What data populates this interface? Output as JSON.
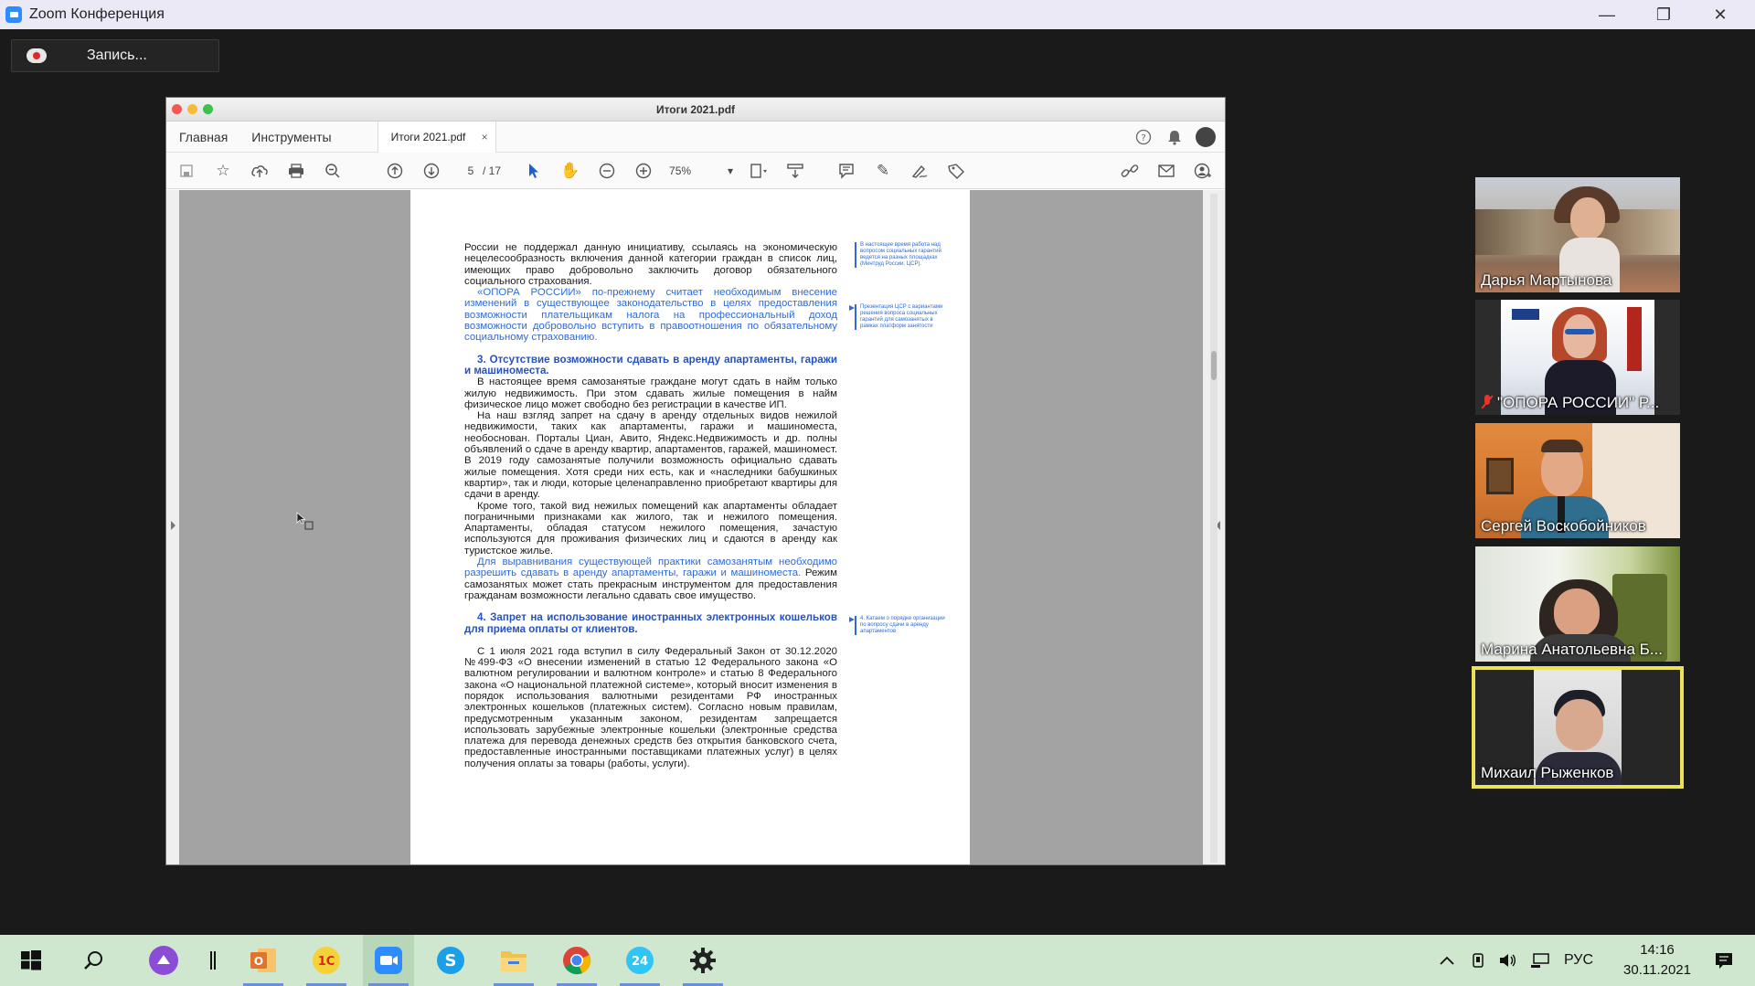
{
  "zoom_window": {
    "title": "Zoom Конференция",
    "minimize": "—",
    "restore": "❐",
    "close": "✕",
    "recording_label": "Запись..."
  },
  "pdf_viewer": {
    "window_title": "Итоги 2021.pdf",
    "menu": {
      "home": "Главная",
      "tools": "Инструменты"
    },
    "tab_title": "Итоги 2021.pdf",
    "tab_close": "×",
    "page_current": "5",
    "page_total": "/ 17",
    "zoom": "75%",
    "zoom_caret": "▾"
  },
  "document": {
    "para1": "России не поддержал данную инициативу, ссылаясь на экономическую нецелесообразность включения данной категории граждан в список лиц, имеющих право добровольно заключить договор обязательного социального страхования.",
    "para2": "«ОПОРА РОССИИ» по-прежнему считает необходимым внесение изменений в существующее законодательство в целях предоставления возможности плательщикам налога на профессиональный доход возможности добровольно вступить в правоотношения по обязательному социальному страхованию.",
    "heading3": "3. Отсутствие возможности сдавать в аренду апартаменты, гаражи и машиноместа.",
    "para3": "В настоящее время самозанятые граждане могут сдать в найм только жилую недвижимость. При этом сдавать жилые помещения в найм физическое лицо может свободно без регистрации в качестве ИП.",
    "para4": "На наш взгляд запрет на сдачу в аренду отдельных видов нежилой недвижимости, таких как апартаменты, гаражи и машиноместа, необоснован. Порталы Циан, Авито, Яндекс.Недвижимость и др. полны объявлений о сдаче в аренду квартир, апартаментов, гаражей, машиномест. В 2019 году самозанятые получили возможность официально сдавать жилые помещения. Хотя среди них есть, как и «наследники бабушкиных квартир», так и люди, которые целенаправленно приобретают квартиры для сдачи в аренду.",
    "para5": "Кроме того, такой вид нежилых помещений как апартаменты обладает пограничными признаками как жилого, так и нежилого помещения. Апартаменты, обладая статусом нежилого помещения, зачастую используются для проживания физических лиц и сдаются в аренду как туристское жилье.",
    "para6_blue": "Для выравнивания существующей практики самозанятым необходимо разрешить сдавать в аренду апартаменты, гаражи и машиноместа.",
    "para6_black": " Режим самозанятых может стать прекрасным инструментом для предоставления гражданам возможности легально сдавать свое имущество.",
    "heading4": "4. Запрет на использование иностранных электронных кошельков для приема оплаты от клиентов.",
    "para7": "С 1 июля 2021 года вступил в силу Федеральный Закон от 30.12.2020 №499-ФЗ «О внесении изменений в статью 12 Федерального закона «О валютном регулировании и валютном контроле» и статью 8 Федерального закона «О национальной платежной системе», который вносит изменения в порядок использования валютными резидентами РФ иностранных электронных кошельков (платежных систем). Согласно новым правилам, предусмотренным указанным законом, резидентам запрещается использовать зарубежные электронные кошельки (электронные средства платежа для перевода денежных средств без открытия банковского счета, предоставленные иностранными поставщиками платежных услуг) в целях получения оплаты за товары (работы, услуги).",
    "note1": "В настоящее время работа над вопросом социальных гарантий ведется на разных площадках (Минтруд России, ЦСР).",
    "note2": "Презентация ЦСР с вариантами решения вопроса социальных гарантий для самозанятых в рамках платформ занятости",
    "note3": "4. Катаем о порядке организации по вопросу сдачи в аренду апартаментов"
  },
  "participants": [
    {
      "name": "Дарья Мартынова",
      "muted": false,
      "active": false
    },
    {
      "name": "\"ОПОРА РОССИИ\" Р...",
      "muted": true,
      "active": false
    },
    {
      "name": "Сергей Воскобойников",
      "muted": false,
      "active": false
    },
    {
      "name": "Марина Анатольевна Б...",
      "muted": false,
      "active": false
    },
    {
      "name": "Михаил Рыженков",
      "muted": false,
      "active": true
    }
  ],
  "taskbar": {
    "language": "РУС",
    "time": "14:16",
    "date": "30.11.2021",
    "apps": [
      "windows-start",
      "search",
      "cortana",
      "divider",
      "outlook",
      "1c",
      "zoom",
      "skype",
      "file-explorer",
      "chrome",
      "bitrix24",
      "settings"
    ]
  },
  "colors": {
    "accent_blue": "#2f6bd6",
    "active_speaker": "#e8e35a",
    "taskbar": "#cfe6cf",
    "zoom_title": "#ece9f6"
  }
}
